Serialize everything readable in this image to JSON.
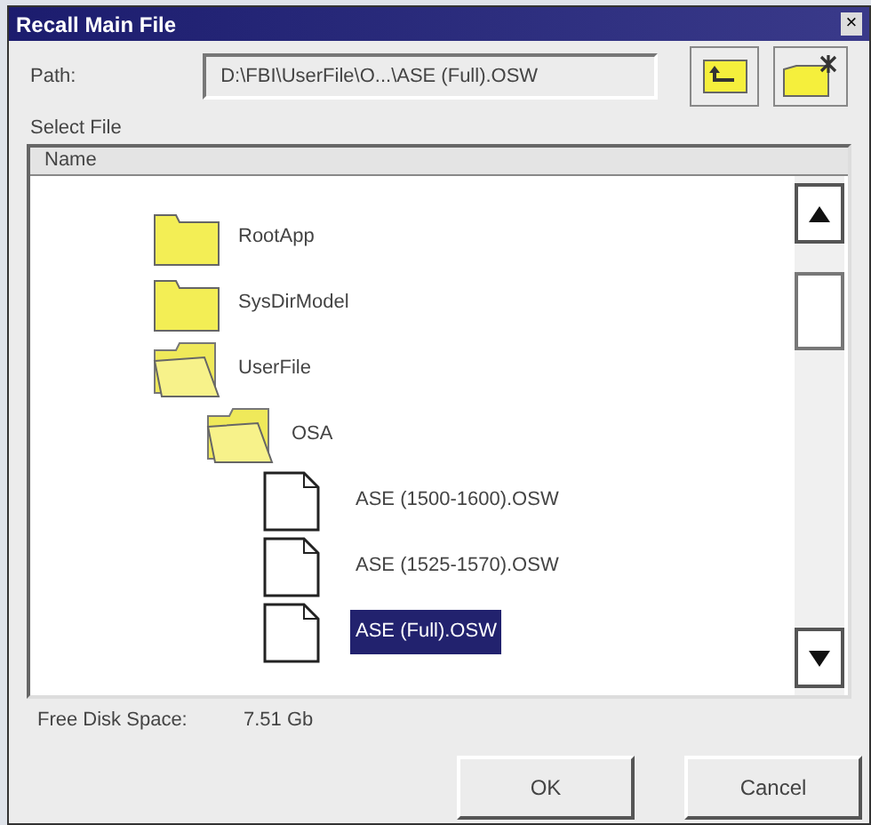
{
  "window": {
    "title": "Recall Main File",
    "close": "×"
  },
  "path": {
    "label": "Path:",
    "value": "D:\\FBI\\UserFile\\O...\\ASE (Full).OSW"
  },
  "select_label": "Select File",
  "list": {
    "column": "Name",
    "items": [
      {
        "kind": "folder",
        "label": "RootApp",
        "expanded": false,
        "selected": false
      },
      {
        "kind": "folder",
        "label": "SysDirModel",
        "expanded": false,
        "selected": false
      },
      {
        "kind": "folder",
        "label": "UserFile",
        "expanded": true,
        "selected": false,
        "children": [
          {
            "kind": "folder",
            "label": "OSA",
            "expanded": true,
            "selected": false,
            "children": [
              {
                "kind": "file",
                "label": "ASE (1500-1600).OSW",
                "selected": false
              },
              {
                "kind": "file",
                "label": "ASE (1525-1570).OSW",
                "selected": false
              },
              {
                "kind": "file",
                "label": "ASE (Full).OSW",
                "selected": true
              }
            ]
          }
        ]
      }
    ]
  },
  "disk": {
    "label": "Free Disk Space:",
    "value": "7.51 Gb"
  },
  "buttons": [
    "OK",
    "Cancel"
  ]
}
